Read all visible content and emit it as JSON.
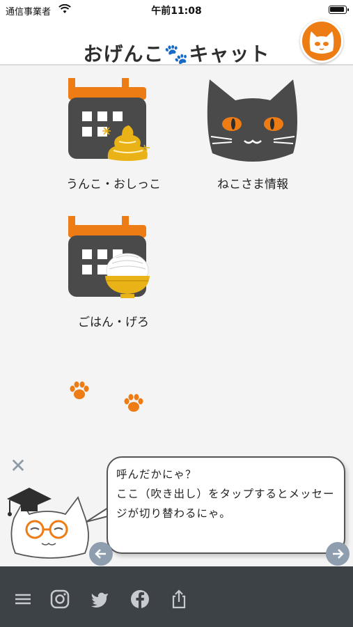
{
  "status_bar": {
    "carrier": "通信事業者",
    "time": "午前11:08"
  },
  "header": {
    "logo_part1": "おげんこ",
    "logo_paw": "🐾",
    "logo_part2": "キャット"
  },
  "menu": [
    {
      "label": "うんこ・おしっこ"
    },
    {
      "label": "ねこさま情報"
    },
    {
      "label": "ごはん・げろ"
    }
  ],
  "message": {
    "text": "呼んだかにゃ？\nここ（吹き出し）をタップするとメッセージが切り替わるにゃ。"
  },
  "colors": {
    "accent": "#ee7c15",
    "dark": "#4a4a4a",
    "toolbar": "#3d4247"
  }
}
